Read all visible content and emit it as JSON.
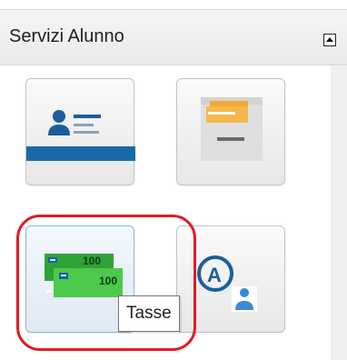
{
  "panel": {
    "title": "Servizi Alunno",
    "collapse_icon": "collapse-up-icon"
  },
  "tiles": [
    {
      "name": "anagrafica",
      "icon": "id-card-icon"
    },
    {
      "name": "archivio",
      "icon": "file-cabinet-icon"
    },
    {
      "name": "tasse",
      "icon": "banknotes-icon",
      "banknote_value": "100"
    },
    {
      "name": "accessibility",
      "icon": "account-a-icon"
    }
  ],
  "tooltip": {
    "text": "Tasse"
  },
  "colors": {
    "accent_blue": "#1a5f9c",
    "folder_orange": "#f3a935",
    "money_green": "#3bbd3a",
    "highlight_red": "#e11b22"
  }
}
